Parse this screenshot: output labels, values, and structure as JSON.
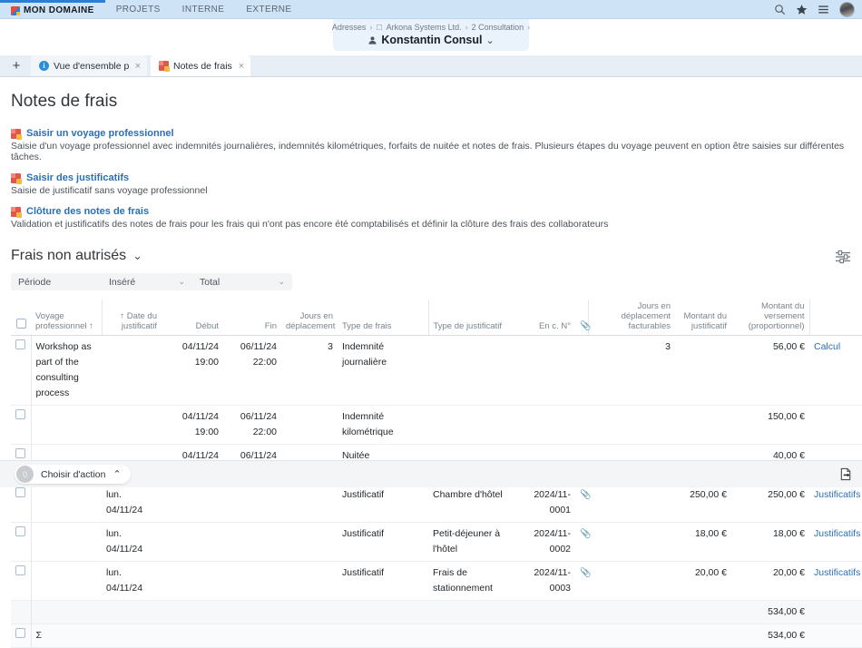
{
  "topbar": {
    "brand": "MON DOMAINE",
    "menu": [
      "PROJETS",
      "INTERNE",
      "EXTERNE"
    ],
    "icons": [
      "search-icon",
      "star-icon",
      "menu-icon",
      "avatar"
    ]
  },
  "header": {
    "breadcrumbs": [
      "Adresses",
      "Arkona Systems Ltd.",
      "2 Consultation"
    ],
    "title": "Konstantin Consul",
    "chevron": "⌄"
  },
  "tabs": [
    {
      "label": "Vue d'ensemble person",
      "icon": "info-icon",
      "active": false,
      "close": "×"
    },
    {
      "label": "Notes de frais",
      "icon": "tile-icon",
      "active": true,
      "close": "×"
    }
  ],
  "tab_add": "+",
  "page": {
    "title": "Notes de frais",
    "actions": [
      {
        "link": "Saisir un voyage professionnel",
        "desc": "Saisie d'un voyage professionnel avec indemnités journalières, indemnités kilométriques, forfaits de nuitée et notes de frais. Plusieurs étapes du voyage peuvent en option être saisies sur différentes tâches."
      },
      {
        "link": "Saisir des justificatifs",
        "desc": "Saisie de justificatif sans voyage professionnel"
      },
      {
        "link": "Clôture des notes de frais",
        "desc": "Validation et justificatifs des notes de frais pour les frais qui n'ont pas encore été comptabilisés et définir la clôture des frais des collaborateurs"
      }
    ]
  },
  "section": {
    "title": "Frais non autrisés",
    "chevron": "⌄",
    "settings_icon": "sliders-icon"
  },
  "filters": {
    "period_label": "Période",
    "inserted_label": "Inséré",
    "total_label": "Total",
    "chevron": "⌄"
  },
  "table": {
    "columns": [
      "Voyage professionnel ↑",
      "↑ Date du justificatif",
      "Début",
      "Fin",
      "Jours en déplacement",
      "Type de frais",
      "Type de justificatif",
      "En c. N°",
      "attachment-icon",
      "Jours en déplacement facturables",
      "Montant du justificatif",
      "Montant du versement (proportionnel)"
    ],
    "rows": [
      {
        "voyage": "Workshop as part of the consulting process",
        "date_justificatif": "",
        "debut": "04/11/24 19:00",
        "fin": "06/11/24 22:00",
        "jours": "3",
        "type_frais": "Indemnité journalière",
        "type_justificatif": "",
        "en_c_n": "",
        "attachment": "",
        "jours_facturables": "3",
        "montant_justificatif": "",
        "montant_versement": "56,00 €",
        "action_link": "Calcul",
        "edit": "edit-icon"
      },
      {
        "voyage": "",
        "date_justificatif": "",
        "debut": "04/11/24 19:00",
        "fin": "06/11/24 22:00",
        "jours": "",
        "type_frais": "Indemnité kilométrique",
        "type_justificatif": "",
        "en_c_n": "",
        "attachment": "",
        "jours_facturables": "",
        "montant_justificatif": "",
        "montant_versement": "150,00 €",
        "action_link": "",
        "edit": "edit-icon"
      },
      {
        "voyage": "",
        "date_justificatif": "",
        "debut": "04/11/24 19:00",
        "fin": "06/11/24 22:00",
        "jours": "",
        "type_frais": "Nuitée",
        "type_justificatif": "",
        "en_c_n": "",
        "attachment": "",
        "jours_facturables": "",
        "montant_justificatif": "",
        "montant_versement": "40,00 €",
        "action_link": "",
        "edit": "edit-icon"
      },
      {
        "voyage": "",
        "date_justificatif": "lun. 04/11/24",
        "debut": "",
        "fin": "",
        "jours": "",
        "type_frais": "Justificatif",
        "type_justificatif": "Chambre d'hôtel",
        "en_c_n": "2024/11-0001",
        "attachment": "attachment-icon",
        "jours_facturables": "",
        "montant_justificatif": "250,00 €",
        "montant_versement": "250,00 €",
        "action_link": "Justificatifs",
        "edit": "edit-icon"
      },
      {
        "voyage": "",
        "date_justificatif": "lun. 04/11/24",
        "debut": "",
        "fin": "",
        "jours": "",
        "type_frais": "Justificatif",
        "type_justificatif": "Petit-déjeuner à l'hôtel",
        "en_c_n": "2024/11-0002",
        "attachment": "attachment-icon",
        "jours_facturables": "",
        "montant_justificatif": "18,00 €",
        "montant_versement": "18,00 €",
        "action_link": "Justificatifs",
        "edit": "edit-icon"
      },
      {
        "voyage": "",
        "date_justificatif": "lun. 04/11/24",
        "debut": "",
        "fin": "",
        "jours": "",
        "type_frais": "Justificatif",
        "type_justificatif": "Frais de stationnement",
        "en_c_n": "2024/11-0003",
        "attachment": "attachment-icon",
        "jours_facturables": "",
        "montant_justificatif": "20,00 €",
        "montant_versement": "20,00 €",
        "action_link": "Justificatifs",
        "edit": "edit-icon"
      }
    ],
    "subtotal": "534,00 €",
    "grandtotal": "534,00 €",
    "sum_symbol": "Σ"
  },
  "footer": {
    "count": "0",
    "action_label": "Choisir d'action",
    "chevron": "⌃",
    "export_icon": "export-icon"
  }
}
